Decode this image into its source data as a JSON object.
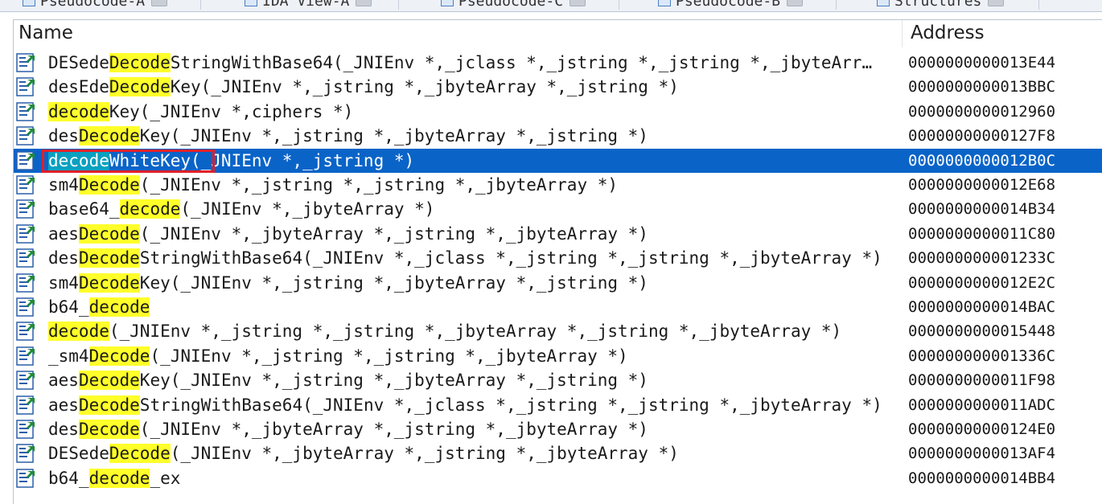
{
  "tabs": [
    {
      "label": "Pseudocode-A"
    },
    {
      "label": "IDA View-A"
    },
    {
      "label": "Pseudocode-C"
    },
    {
      "label": "Pseudocode-B"
    },
    {
      "label": "Structures"
    }
  ],
  "columns": {
    "name": "Name",
    "address": "Address"
  },
  "selected_row": 4,
  "colors": {
    "selection": "#0a64c8",
    "highlight": "#ffff2a",
    "selected_highlight": "#0aa0c0",
    "annotation": "#e0202a"
  },
  "rows": [
    {
      "pre": "DESede",
      "hl": "Decode",
      "post": "StringWithBase64(_JNIEnv *,_jclass *,_jstring *,_jstring *,_jbyteArr…",
      "address": "0000000000013E44"
    },
    {
      "pre": "desEde",
      "hl": "Decode",
      "post": "Key(_JNIEnv *,_jstring *,_jbyteArray *,_jstring *)",
      "address": "0000000000013BBC"
    },
    {
      "pre": "",
      "hl": "decode",
      "post": "Key(_JNIEnv *,ciphers *)",
      "address": "0000000000012960"
    },
    {
      "pre": "des",
      "hl": "Decode",
      "post": "Key(_JNIEnv *,_jstring *,_jbyteArray *,_jstring *)",
      "address": "00000000000127F8"
    },
    {
      "pre": "",
      "hl": "decode",
      "post": "WhiteKey(_JNIEnv *,_jstring *)",
      "address": "0000000000012B0C"
    },
    {
      "pre": "sm4",
      "hl": "Decode",
      "post": "(_JNIEnv *,_jstring *,_jstring *,_jbyteArray *)",
      "address": "0000000000012E68"
    },
    {
      "pre": "base64_",
      "hl": "decode",
      "post": "(_JNIEnv *,_jbyteArray *)",
      "address": "0000000000014B34"
    },
    {
      "pre": "aes",
      "hl": "Decode",
      "post": "(_JNIEnv *,_jbyteArray *,_jstring *,_jbyteArray *)",
      "address": "0000000000011C80"
    },
    {
      "pre": "des",
      "hl": "Decode",
      "post": "StringWithBase64(_JNIEnv *,_jclass *,_jstring *,_jstring *,_jbyteArray *)",
      "address": "000000000001233C"
    },
    {
      "pre": "sm4",
      "hl": "Decode",
      "post": "Key(_JNIEnv *,_jstring *,_jbyteArray *,_jstring *)",
      "address": "0000000000012E2C"
    },
    {
      "pre": "b64_",
      "hl": "decode",
      "post": "",
      "address": "0000000000014BAC"
    },
    {
      "pre": "",
      "hl": "decode",
      "post": "(_JNIEnv *,_jstring *,_jstring *,_jbyteArray *,_jstring *,_jbyteArray *)",
      "address": "0000000000015448"
    },
    {
      "pre": "_sm4",
      "hl": "Decode",
      "post": "(_JNIEnv *,_jstring *,_jstring *,_jbyteArray *)",
      "address": "000000000001336C"
    },
    {
      "pre": "aes",
      "hl": "Decode",
      "post": "Key(_JNIEnv *,_jstring *,_jbyteArray *,_jstring *)",
      "address": "0000000000011F98"
    },
    {
      "pre": "aes",
      "hl": "Decode",
      "post": "StringWithBase64(_JNIEnv *,_jclass *,_jstring *,_jstring *,_jbyteArray *)",
      "address": "0000000000011ADC"
    },
    {
      "pre": "des",
      "hl": "Decode",
      "post": "(_JNIEnv *,_jbyteArray *,_jstring *,_jbyteArray *)",
      "address": "00000000000124E0"
    },
    {
      "pre": "DESede",
      "hl": "Decode",
      "post": "(_JNIEnv *,_jbyteArray *,_jstring *,_jbyteArray *)",
      "address": "0000000000013AF4"
    },
    {
      "pre": "b64_",
      "hl": "decode",
      "post": "_ex",
      "address": "0000000000014BB4"
    }
  ]
}
